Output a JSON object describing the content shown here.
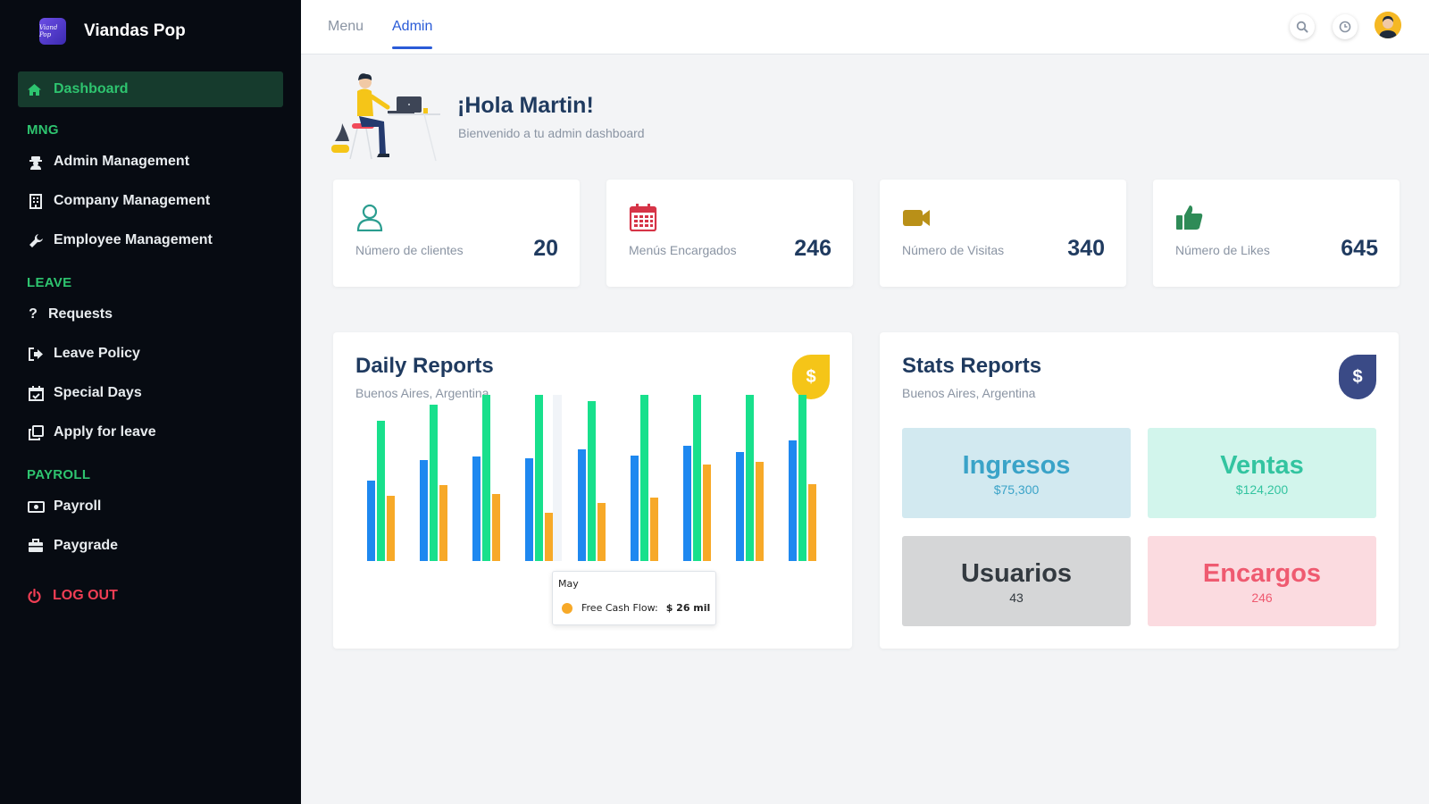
{
  "brand": {
    "name": "Viandas Pop",
    "logo_text": "Viand Pop"
  },
  "sidebar": {
    "active_item": "Dashboard",
    "sections": [
      {
        "title": "MNG",
        "items": [
          {
            "label": "Admin Management",
            "icon": "user-secret-icon"
          },
          {
            "label": "Company Management",
            "icon": "building-icon"
          },
          {
            "label": "Employee Management",
            "icon": "wrench-icon"
          }
        ]
      },
      {
        "title": "LEAVE",
        "items": [
          {
            "label": "Requests",
            "icon": "question-icon"
          },
          {
            "label": "Leave Policy",
            "icon": "sign-out-icon"
          },
          {
            "label": "Special Days",
            "icon": "calendar-check-icon"
          },
          {
            "label": "Apply for leave",
            "icon": "copy-icon"
          }
        ]
      },
      {
        "title": "PAYROLL",
        "items": [
          {
            "label": "Payroll",
            "icon": "money-bill-icon"
          },
          {
            "label": "Paygrade",
            "icon": "briefcase-icon"
          }
        ]
      }
    ],
    "logout": "LOG OUT"
  },
  "topbar": {
    "tabs": [
      "Menu",
      "Admin"
    ],
    "active_tab": "Admin"
  },
  "greeting": {
    "title": "¡Hola Martin!",
    "subtitle": "Bienvenido a tu admin dashboard"
  },
  "stats": [
    {
      "label": "Número de clientes",
      "value": "20",
      "icon": "user-icon",
      "color": "#2a9d8f"
    },
    {
      "label": "Menús Encargados",
      "value": "246",
      "icon": "calendar-icon",
      "color": "#d63447"
    },
    {
      "label": "Número de Visitas",
      "value": "340",
      "icon": "video-icon",
      "color": "#b99018"
    },
    {
      "label": "Número de Likes",
      "value": "645",
      "icon": "thumbs-up-icon",
      "color": "#2e8b57"
    }
  ],
  "daily_reports": {
    "title": "Daily Reports",
    "subtitle": "Buenos Aires, Argentina",
    "badge": "$",
    "badge_color": "#f5c518"
  },
  "chart_data": {
    "type": "bar",
    "categories": [
      "",
      "",
      "",
      "",
      "",
      "",
      "",
      "",
      ""
    ],
    "series": [
      {
        "color": "#1e88f0",
        "values": [
          90,
          113,
          117,
          115,
          125,
          118,
          129,
          122,
          135
        ]
      },
      {
        "name": "",
        "color": "#18e08c",
        "values": [
          157,
          175,
          208,
          202,
          179,
          216,
          188,
          234,
          195
        ]
      },
      {
        "name": "Free Cash Flow",
        "color": "#f7a928",
        "values": [
          73,
          85,
          75,
          54,
          65,
          71,
          108,
          111,
          86
        ]
      }
    ],
    "ylim": [
      0,
      240
    ],
    "grid": false,
    "tooltip": {
      "category": "May",
      "series": "Free Cash Flow",
      "value": "$ 26 mil"
    }
  },
  "stats_reports": {
    "title": "Stats Reports",
    "subtitle": "Buenos Aires, Argentina",
    "badge": "$",
    "badge_color": "#3a4a86",
    "tiles": [
      {
        "label": "Ingresos",
        "value": "$75,300",
        "bg": "#d2e9f0",
        "fg": "#3aa3c8"
      },
      {
        "label": "Ventas",
        "value": "$124,200",
        "bg": "#d2f5ec",
        "fg": "#33c4a0"
      },
      {
        "label": "Usuarios",
        "value": "43",
        "bg": "#d5d6d7",
        "fg": "#333a40"
      },
      {
        "label": "Encargos",
        "value": "246",
        "bg": "#fbdbe0",
        "fg": "#ef5a70"
      }
    ]
  }
}
